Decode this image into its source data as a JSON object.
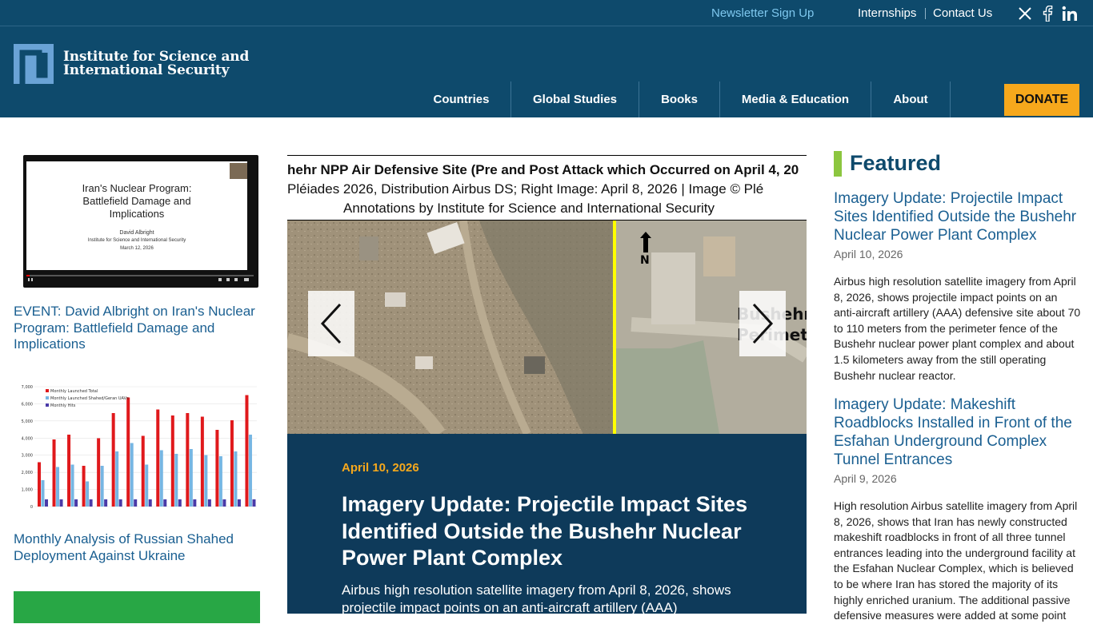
{
  "topbar": {
    "newsletter": "Newsletter Sign Up",
    "internships": "Internships",
    "contact": "Contact Us",
    "social_icons": [
      "x-icon",
      "facebook-icon",
      "linkedin-icon"
    ]
  },
  "brand": {
    "line1": "Institute for Science and",
    "line2": "International Security",
    "color_primary": "#0e4a6c",
    "color_accent": "#f6a81c",
    "color_green": "#8cc63f"
  },
  "nav": {
    "items": [
      "Countries",
      "Global Studies",
      "Books",
      "Media & Education",
      "About"
    ],
    "donate": "DONATE"
  },
  "left": {
    "video": {
      "slide_title": "Iran's Nuclear Program: Battlefield Damage and Implications",
      "presenter": "David Albright",
      "org": "Institute for Science and International Security",
      "date": "March 12, 2026"
    },
    "link1": "EVENT: David Albright on Iran's Nuclear Program: Battlefield Damage and Implications",
    "chart_legend": [
      "Monthly Launched Total",
      "Monthly Launched Shahed/Geran UAVs",
      "Monthly Hits"
    ],
    "chart_yticks": [
      "7,000",
      "6,000",
      "5,000",
      "4,000",
      "3,000",
      "2,000",
      "1,000",
      "0"
    ],
    "link2": "Monthly Analysis of Russian Shahed Deployment Against Ukraine"
  },
  "slider": {
    "caption_line1": "hehr NPP Air Defensive Site (Pre and Post Attack which Occurred on April 4, 20",
    "caption_line2": "Pléiades 2026, Distribution Airbus DS; Right Image: April 8, 2026 | Image © Plé",
    "caption_line3": "Annotations by Institute for Science and International Security",
    "north_label": "N",
    "overlay_line1": "Bushehr",
    "overlay_line2": "Perimete"
  },
  "story": {
    "date": "April 10, 2026",
    "title": "Imagery Update: Projectile Impact Sites Identified Outside the Bushehr Nuclear Power Plant Complex",
    "text": "Airbus high resolution satellite imagery from April 8, 2026, shows projectile impact points on an anti-aircraft artillery (AAA)"
  },
  "featured": {
    "heading": "Featured",
    "items": [
      {
        "title": "Imagery Update: Projectile Impact Sites Identified Outside the Bushehr Nuclear Power Plant Complex",
        "date": "April 10, 2026",
        "text": "Airbus high resolution satellite imagery from April 8, 2026, shows projectile impact points on an anti-aircraft artillery (AAA) defensive site about 70 to 110 meters from the perimeter fence of the Bushehr nuclear power plant complex and about 1.5 kilometers away from the still operating Bushehr nuclear reactor."
      },
      {
        "title": "Imagery Update: Makeshift Roadblocks Installed in Front of the Esfahan Underground Complex Tunnel Entrances",
        "date": "April 9, 2026",
        "text": "High resolution Airbus satellite imagery from April 8, 2026, shows that Iran has newly constructed makeshift roadblocks in front of all three tunnel entrances leading into the underground facility at the Esfahan Nuclear Complex, which is believed to be where Iran has stored the majority of its highly enriched uranium. The additional passive defensive measures were added at some point"
      }
    ]
  }
}
